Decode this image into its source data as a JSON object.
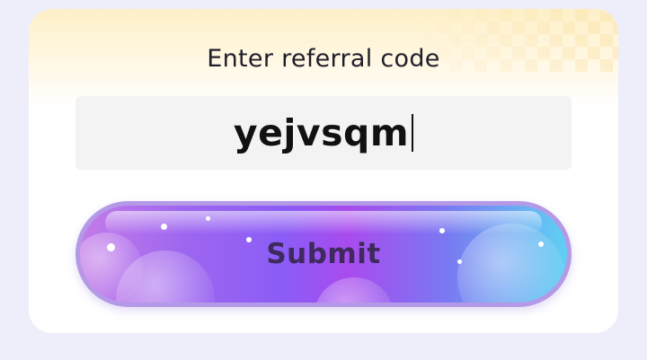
{
  "dialog": {
    "title": "Enter referral code",
    "code_value": "yejvsqm",
    "submit_label": "Submit"
  },
  "colors": {
    "background": "#eeeefa",
    "card": "#ffffff",
    "field_bg": "#f3f3f3",
    "button_border": "#b49ae6",
    "button_text": "#3f2a5e"
  }
}
